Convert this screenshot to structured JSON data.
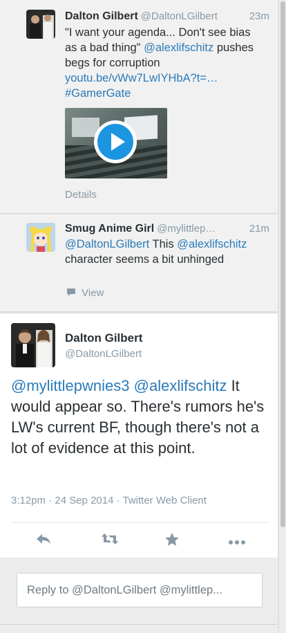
{
  "timeline": {
    "tweet1": {
      "fullname": "Dalton Gilbert",
      "handle": "@DaltonLGilbert",
      "time": "23m",
      "text_part1": "\"I want your agenda... Don't see bias as a bad thing\" ",
      "mention": "@alexlifschitz",
      "text_part2": " pushes begs for corruption ",
      "url": "youtu.be/vWw7LwIYHbA?t=…",
      "hashtag": "#GamerGate",
      "details_label": "Details"
    },
    "tweet2": {
      "fullname": "Smug Anime Girl",
      "handle": "@mylittlep…",
      "time": "21m",
      "mention1": "@DaltonLGilbert",
      "text_part1": " This ",
      "mention2": "@alexlifschitz",
      "text_part2": " character seems a bit unhinged",
      "view_icon": "speech-bubble-icon",
      "view_label": "View"
    }
  },
  "focused_tweet": {
    "fullname": "Dalton Gilbert",
    "handle": "@DaltonLGilbert",
    "mention1": "@mylittlepwnies3",
    "mention2": "@alexlifschitz",
    "text": " It would appear so. There's rumors he's LW's current BF, though there's not a lot of evidence at this point.",
    "timestamp": "3:12pm · 24 Sep 2014 · Twitter Web Client",
    "actions": {
      "reply_icon": "reply-icon",
      "retweet_icon": "retweet-icon",
      "favorite_icon": "star-icon",
      "more_icon": "more-icon"
    }
  },
  "reply": {
    "placeholder": "Reply to @DaltonLGilbert @mylittlep..."
  },
  "colors": {
    "link": "#2b7bb9",
    "muted": "#8899a6",
    "text": "#292f33",
    "play": "#1b95e0"
  }
}
